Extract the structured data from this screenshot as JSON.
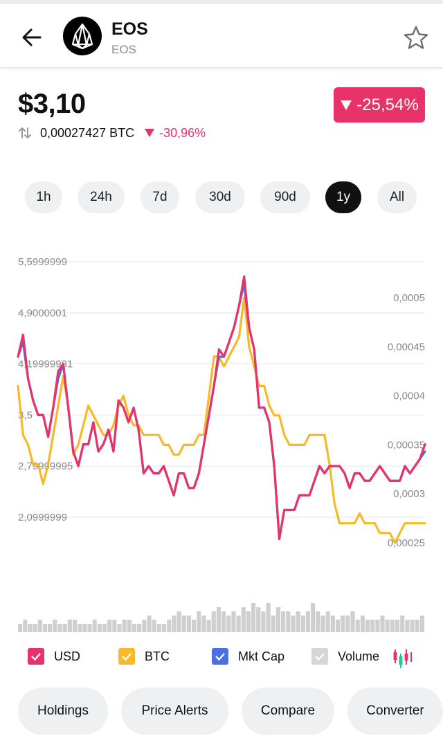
{
  "header": {
    "coin_name": "EOS",
    "coin_symbol": "EOS"
  },
  "price": {
    "usd": "$3,10",
    "change_pct": "-25,54%",
    "btc_value": "0,00027427 BTC",
    "btc_change_pct": "-30,96%"
  },
  "periods": [
    "1h",
    "24h",
    "7d",
    "30d",
    "90d",
    "1y",
    "All"
  ],
  "active_period": "1y",
  "chart_data": {
    "type": "line",
    "x_range": "1y",
    "left_axis_ticks": [
      "5,5999999",
      "4,9000001",
      "4,19999981",
      "3,5",
      "2,79999995",
      "2,0999999"
    ],
    "right_axis_ticks": [
      "0,0005",
      "0,00045",
      "0,0004",
      "0,00035",
      "0,0003",
      "0,00025"
    ],
    "ylim_left": [
      2.1,
      5.6
    ],
    "ylim_right": [
      0.00025,
      0.0005
    ],
    "series": [
      {
        "name": "USD",
        "color": "#e8336a",
        "values": [
          4.3,
          4.6,
          4.0,
          3.7,
          3.5,
          3.5,
          3.2,
          3.6,
          4.1,
          4.2,
          3.6,
          3.0,
          2.8,
          3.1,
          3.1,
          3.4,
          3.0,
          3.1,
          3.3,
          3.0,
          3.7,
          3.6,
          3.4,
          3.6,
          3.3,
          2.7,
          2.8,
          2.7,
          2.7,
          2.8,
          2.6,
          2.4,
          2.7,
          2.7,
          2.5,
          2.5,
          2.7,
          3.1,
          3.5,
          3.9,
          4.4,
          4.3,
          4.5,
          4.7,
          5.0,
          5.4,
          4.7,
          4.4,
          3.6,
          3.6,
          3.4,
          2.8,
          1.8,
          2.2,
          2.2,
          2.2,
          2.4,
          2.4,
          2.4,
          2.6,
          2.8,
          2.7,
          2.8,
          2.8,
          2.8,
          2.7,
          2.5,
          2.7,
          2.7,
          2.6,
          2.6,
          2.7,
          2.8,
          2.7,
          2.6,
          2.6,
          2.6,
          2.8,
          2.7,
          2.8,
          2.9,
          3.1
        ]
      },
      {
        "name": "BTC",
        "color": "#f7b928",
        "values": [
          0.00041,
          0.00036,
          0.00035,
          0.00033,
          0.00033,
          0.00031,
          0.00033,
          0.00036,
          0.00039,
          0.00042,
          0.00039,
          0.00034,
          0.00035,
          0.00037,
          0.00039,
          0.00038,
          0.00037,
          0.00036,
          0.00036,
          0.00037,
          0.00039,
          0.0004,
          0.00038,
          0.00037,
          0.00037,
          0.00036,
          0.00036,
          0.00036,
          0.00036,
          0.00035,
          0.00035,
          0.00034,
          0.00034,
          0.00035,
          0.00035,
          0.00035,
          0.00036,
          0.00036,
          0.0004,
          0.00044,
          0.00044,
          0.00043,
          0.00044,
          0.00045,
          0.00046,
          0.0005,
          0.00045,
          0.00043,
          0.00041,
          0.00041,
          0.00039,
          0.00038,
          0.00038,
          0.00036,
          0.00035,
          0.00035,
          0.00035,
          0.00035,
          0.00036,
          0.00036,
          0.00036,
          0.00036,
          0.00033,
          0.00029,
          0.00027,
          0.00027,
          0.00027,
          0.00027,
          0.00028,
          0.00027,
          0.00027,
          0.00027,
          0.00026,
          0.00026,
          0.00026,
          0.00025,
          0.00026,
          0.00027,
          0.00027,
          0.00027,
          0.00027,
          0.00027
        ]
      },
      {
        "name": "Mkt Cap",
        "color": "#4a6fe3",
        "values": [
          4.3,
          4.5,
          4.0,
          3.7,
          3.5,
          3.5,
          3.2,
          3.6,
          4.0,
          4.2,
          3.6,
          3.0,
          2.8,
          3.1,
          3.1,
          3.4,
          3.0,
          3.1,
          3.3,
          3.0,
          3.7,
          3.6,
          3.4,
          3.6,
          3.3,
          2.7,
          2.8,
          2.7,
          2.7,
          2.8,
          2.6,
          2.4,
          2.7,
          2.7,
          2.5,
          2.5,
          2.7,
          3.1,
          3.5,
          3.9,
          4.3,
          4.3,
          4.5,
          4.7,
          5.0,
          5.3,
          4.7,
          4.4,
          3.6,
          3.6,
          3.4,
          2.8,
          1.8,
          2.2,
          2.2,
          2.2,
          2.4,
          2.4,
          2.4,
          2.6,
          2.8,
          2.7,
          2.8,
          2.8,
          2.8,
          2.7,
          2.5,
          2.7,
          2.7,
          2.6,
          2.6,
          2.7,
          2.8,
          2.7,
          2.6,
          2.6,
          2.6,
          2.8,
          2.7,
          2.8,
          2.9,
          3.0
        ]
      },
      {
        "name": "Volume",
        "color": "#cfcfcf",
        "values": [
          2,
          3,
          2,
          2,
          3,
          2,
          2,
          3,
          2,
          2,
          3,
          3,
          2,
          2,
          2,
          3,
          2,
          2,
          3,
          3,
          2,
          3,
          3,
          2,
          2,
          3,
          4,
          3,
          2,
          2,
          3,
          4,
          5,
          4,
          4,
          3,
          5,
          4,
          3,
          5,
          6,
          5,
          4,
          5,
          4,
          6,
          5,
          7,
          6,
          5,
          7,
          4,
          6,
          5,
          5,
          4,
          5,
          4,
          5,
          7,
          5,
          4,
          5,
          4,
          3,
          4,
          4,
          5,
          3,
          4,
          3,
          3,
          3,
          4,
          3,
          3,
          3,
          4,
          3,
          3,
          3,
          4
        ]
      }
    ]
  },
  "legend": [
    {
      "label": "USD",
      "color": "#e8336a"
    },
    {
      "label": "BTC",
      "color": "#f7b928"
    },
    {
      "label": "Mkt Cap",
      "color": "#4a6fe3"
    },
    {
      "label": "Volume",
      "color": "#cfcfcf"
    }
  ],
  "actions": [
    "Holdings",
    "Price Alerts",
    "Compare",
    "Converter"
  ]
}
